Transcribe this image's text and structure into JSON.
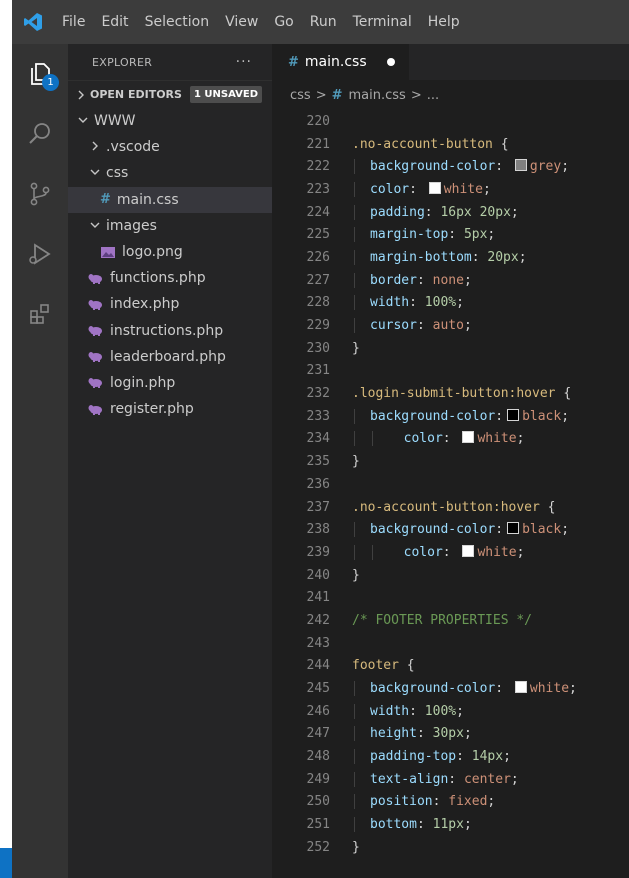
{
  "menu": [
    "File",
    "Edit",
    "Selection",
    "View",
    "Go",
    "Run",
    "Terminal",
    "Help"
  ],
  "activity": {
    "explorer_badge": "1"
  },
  "explorer": {
    "title": "EXPLORER",
    "more": "···",
    "open_editors": "OPEN EDITORS",
    "unsaved": "1 UNSAVED",
    "tree": [
      {
        "label": "WWW",
        "depth": 0,
        "kind": "folder-open"
      },
      {
        "label": ".vscode",
        "depth": 1,
        "kind": "folder-closed"
      },
      {
        "label": "css",
        "depth": 1,
        "kind": "folder-open"
      },
      {
        "label": "main.css",
        "depth": 2,
        "kind": "css",
        "selected": true
      },
      {
        "label": "images",
        "depth": 1,
        "kind": "folder-open"
      },
      {
        "label": "logo.png",
        "depth": 2,
        "kind": "image"
      },
      {
        "label": "functions.php",
        "depth": 1,
        "kind": "php"
      },
      {
        "label": "index.php",
        "depth": 1,
        "kind": "php"
      },
      {
        "label": "instructions.php",
        "depth": 1,
        "kind": "php"
      },
      {
        "label": "leaderboard.php",
        "depth": 1,
        "kind": "php"
      },
      {
        "label": "login.php",
        "depth": 1,
        "kind": "php"
      },
      {
        "label": "register.php",
        "depth": 1,
        "kind": "php"
      }
    ]
  },
  "tab": {
    "hash": "#",
    "label": "main.css"
  },
  "breadcrumb": {
    "folder": "css",
    "sep": ">",
    "hash": "#",
    "file": "main.css",
    "more": "..."
  },
  "colors": {
    "grey": "#808080",
    "white": "#ffffff",
    "black": "#000000"
  },
  "code": [
    {
      "n": "220",
      "t": []
    },
    {
      "n": "221",
      "t": [
        [
          "sel",
          ".no-account-button"
        ],
        [
          "pun",
          " {"
        ]
      ]
    },
    {
      "n": "222",
      "g": 1,
      "t": [
        [
          "prop",
          "background-color"
        ],
        [
          "pun",
          ": "
        ],
        [
          "sw",
          "grey"
        ],
        [
          "val",
          "grey"
        ],
        [
          "pun",
          ";"
        ]
      ]
    },
    {
      "n": "223",
      "g": 1,
      "t": [
        [
          "prop",
          "color"
        ],
        [
          "pun",
          ": "
        ],
        [
          "sw",
          "white"
        ],
        [
          "val",
          "white"
        ],
        [
          "pun",
          ";"
        ]
      ]
    },
    {
      "n": "224",
      "g": 1,
      "t": [
        [
          "prop",
          "padding"
        ],
        [
          "pun",
          ": "
        ],
        [
          "num",
          "16px 20px"
        ],
        [
          "pun",
          ";"
        ]
      ]
    },
    {
      "n": "225",
      "g": 1,
      "t": [
        [
          "prop",
          "margin-top"
        ],
        [
          "pun",
          ": "
        ],
        [
          "num",
          "5px"
        ],
        [
          "pun",
          ";"
        ]
      ]
    },
    {
      "n": "226",
      "g": 1,
      "t": [
        [
          "prop",
          "margin-bottom"
        ],
        [
          "pun",
          ": "
        ],
        [
          "num",
          "20px"
        ],
        [
          "pun",
          ";"
        ]
      ]
    },
    {
      "n": "227",
      "g": 1,
      "t": [
        [
          "prop",
          "border"
        ],
        [
          "pun",
          ": "
        ],
        [
          "val",
          "none"
        ],
        [
          "pun",
          ";"
        ]
      ]
    },
    {
      "n": "228",
      "g": 1,
      "t": [
        [
          "prop",
          "width"
        ],
        [
          "pun",
          ": "
        ],
        [
          "num",
          "100%"
        ],
        [
          "pun",
          ";"
        ]
      ]
    },
    {
      "n": "229",
      "g": 1,
      "t": [
        [
          "prop",
          "cursor"
        ],
        [
          "pun",
          ": "
        ],
        [
          "val",
          "auto"
        ],
        [
          "pun",
          ";"
        ]
      ]
    },
    {
      "n": "230",
      "t": [
        [
          "pun",
          "}"
        ]
      ]
    },
    {
      "n": "231",
      "t": []
    },
    {
      "n": "232",
      "t": [
        [
          "sel",
          ".login-submit-button:hover"
        ],
        [
          "pun",
          " {"
        ]
      ]
    },
    {
      "n": "233",
      "g": 1,
      "t": [
        [
          "prop",
          "background-color"
        ],
        [
          "pun",
          ":"
        ],
        [
          "sw",
          "black"
        ],
        [
          "val",
          "black"
        ],
        [
          "pun",
          ";"
        ]
      ]
    },
    {
      "n": "234",
      "g": 2,
      "t": [
        [
          "pun",
          "  "
        ],
        [
          "prop",
          "color"
        ],
        [
          "pun",
          ": "
        ],
        [
          "sw",
          "white"
        ],
        [
          "val",
          "white"
        ],
        [
          "pun",
          ";"
        ]
      ]
    },
    {
      "n": "235",
      "t": [
        [
          "pun",
          "}"
        ]
      ]
    },
    {
      "n": "236",
      "t": []
    },
    {
      "n": "237",
      "t": [
        [
          "sel",
          ".no-account-button:hover"
        ],
        [
          "pun",
          " {"
        ]
      ]
    },
    {
      "n": "238",
      "g": 1,
      "t": [
        [
          "prop",
          "background-color"
        ],
        [
          "pun",
          ":"
        ],
        [
          "sw",
          "black"
        ],
        [
          "val",
          "black"
        ],
        [
          "pun",
          ";"
        ]
      ]
    },
    {
      "n": "239",
      "g": 2,
      "t": [
        [
          "pun",
          "  "
        ],
        [
          "prop",
          "color"
        ],
        [
          "pun",
          ": "
        ],
        [
          "sw",
          "white"
        ],
        [
          "val",
          "white"
        ],
        [
          "pun",
          ";"
        ]
      ]
    },
    {
      "n": "240",
      "t": [
        [
          "pun",
          "}"
        ]
      ]
    },
    {
      "n": "241",
      "t": []
    },
    {
      "n": "242",
      "t": [
        [
          "cmt",
          "/* FOOTER PROPERTIES */"
        ]
      ]
    },
    {
      "n": "243",
      "t": []
    },
    {
      "n": "244",
      "t": [
        [
          "sel",
          "footer"
        ],
        [
          "pun",
          " {"
        ]
      ]
    },
    {
      "n": "245",
      "g": 1,
      "t": [
        [
          "prop",
          "background-color"
        ],
        [
          "pun",
          ": "
        ],
        [
          "sw",
          "white"
        ],
        [
          "val",
          "white"
        ],
        [
          "pun",
          ";"
        ]
      ]
    },
    {
      "n": "246",
      "g": 1,
      "t": [
        [
          "prop",
          "width"
        ],
        [
          "pun",
          ": "
        ],
        [
          "num",
          "100%"
        ],
        [
          "pun",
          ";"
        ]
      ]
    },
    {
      "n": "247",
      "g": 1,
      "t": [
        [
          "prop",
          "height"
        ],
        [
          "pun",
          ": "
        ],
        [
          "num",
          "30px"
        ],
        [
          "pun",
          ";"
        ]
      ]
    },
    {
      "n": "248",
      "g": 1,
      "t": [
        [
          "prop",
          "padding-top"
        ],
        [
          "pun",
          ": "
        ],
        [
          "num",
          "14px"
        ],
        [
          "pun",
          ";"
        ]
      ]
    },
    {
      "n": "249",
      "g": 1,
      "t": [
        [
          "prop",
          "text-align"
        ],
        [
          "pun",
          ": "
        ],
        [
          "val",
          "center"
        ],
        [
          "pun",
          ";"
        ]
      ]
    },
    {
      "n": "250",
      "g": 1,
      "t": [
        [
          "prop",
          "position"
        ],
        [
          "pun",
          ": "
        ],
        [
          "val",
          "fixed"
        ],
        [
          "pun",
          ";"
        ]
      ]
    },
    {
      "n": "251",
      "g": 1,
      "t": [
        [
          "prop",
          "bottom"
        ],
        [
          "pun",
          ": "
        ],
        [
          "num",
          "11px"
        ],
        [
          "pun",
          ";"
        ]
      ]
    },
    {
      "n": "252",
      "t": [
        [
          "pun",
          "}"
        ]
      ]
    }
  ]
}
